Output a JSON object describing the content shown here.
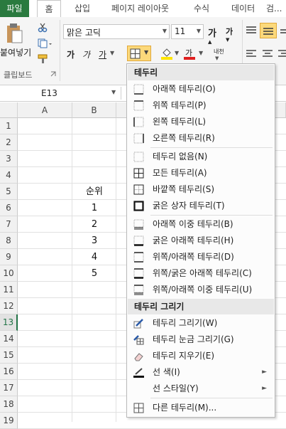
{
  "ribbon": {
    "tabs": [
      "파일",
      "홈",
      "삽입",
      "페이지 레이아웃",
      "수식",
      "데이터",
      "검..."
    ],
    "clipboard": {
      "paste": "붙여넣기",
      "group_label": "클립보드"
    },
    "font": {
      "name": "맑은 고딕",
      "size": "11",
      "bold": "가",
      "italic": "가",
      "underline": "가"
    }
  },
  "namebox": {
    "value": "E13"
  },
  "grid": {
    "columns": [
      "A",
      "B"
    ],
    "rows": [
      "1",
      "2",
      "3",
      "4",
      "5",
      "6",
      "7",
      "8",
      "9",
      "10",
      "11",
      "12",
      "13",
      "14",
      "15",
      "16",
      "17",
      "18",
      "19"
    ],
    "selected_row": "13",
    "cells": {
      "b5": "순위",
      "b6": "1",
      "b7": "2",
      "b8": "3",
      "b9": "4",
      "b10": "5"
    }
  },
  "menu": {
    "header1": "테두리",
    "items": [
      "아래쪽 테두리(O)",
      "위쪽 테두리(P)",
      "왼쪽 테두리(L)",
      "오른쪽 테두리(R)",
      "테두리 없음(N)",
      "모든 테두리(A)",
      "바깥쪽 테두리(S)",
      "굵은 상자 테두리(T)",
      "아래쪽 이중 테두리(B)",
      "굵은 아래쪽 테두리(H)",
      "위쪽/아래쪽 테두리(D)",
      "위쪽/굵은 아래쪽 테두리(C)",
      "위쪽/아래쪽 이중 테두리(U)"
    ],
    "header2": "테두리 그리기",
    "draw_items": [
      "테두리 그리기(W)",
      "테두리 눈금 그리기(G)",
      "테두리 지우기(E)",
      "선 색(I)",
      "선 스타일(Y)"
    ],
    "more": "다른 테두리(M)..."
  }
}
